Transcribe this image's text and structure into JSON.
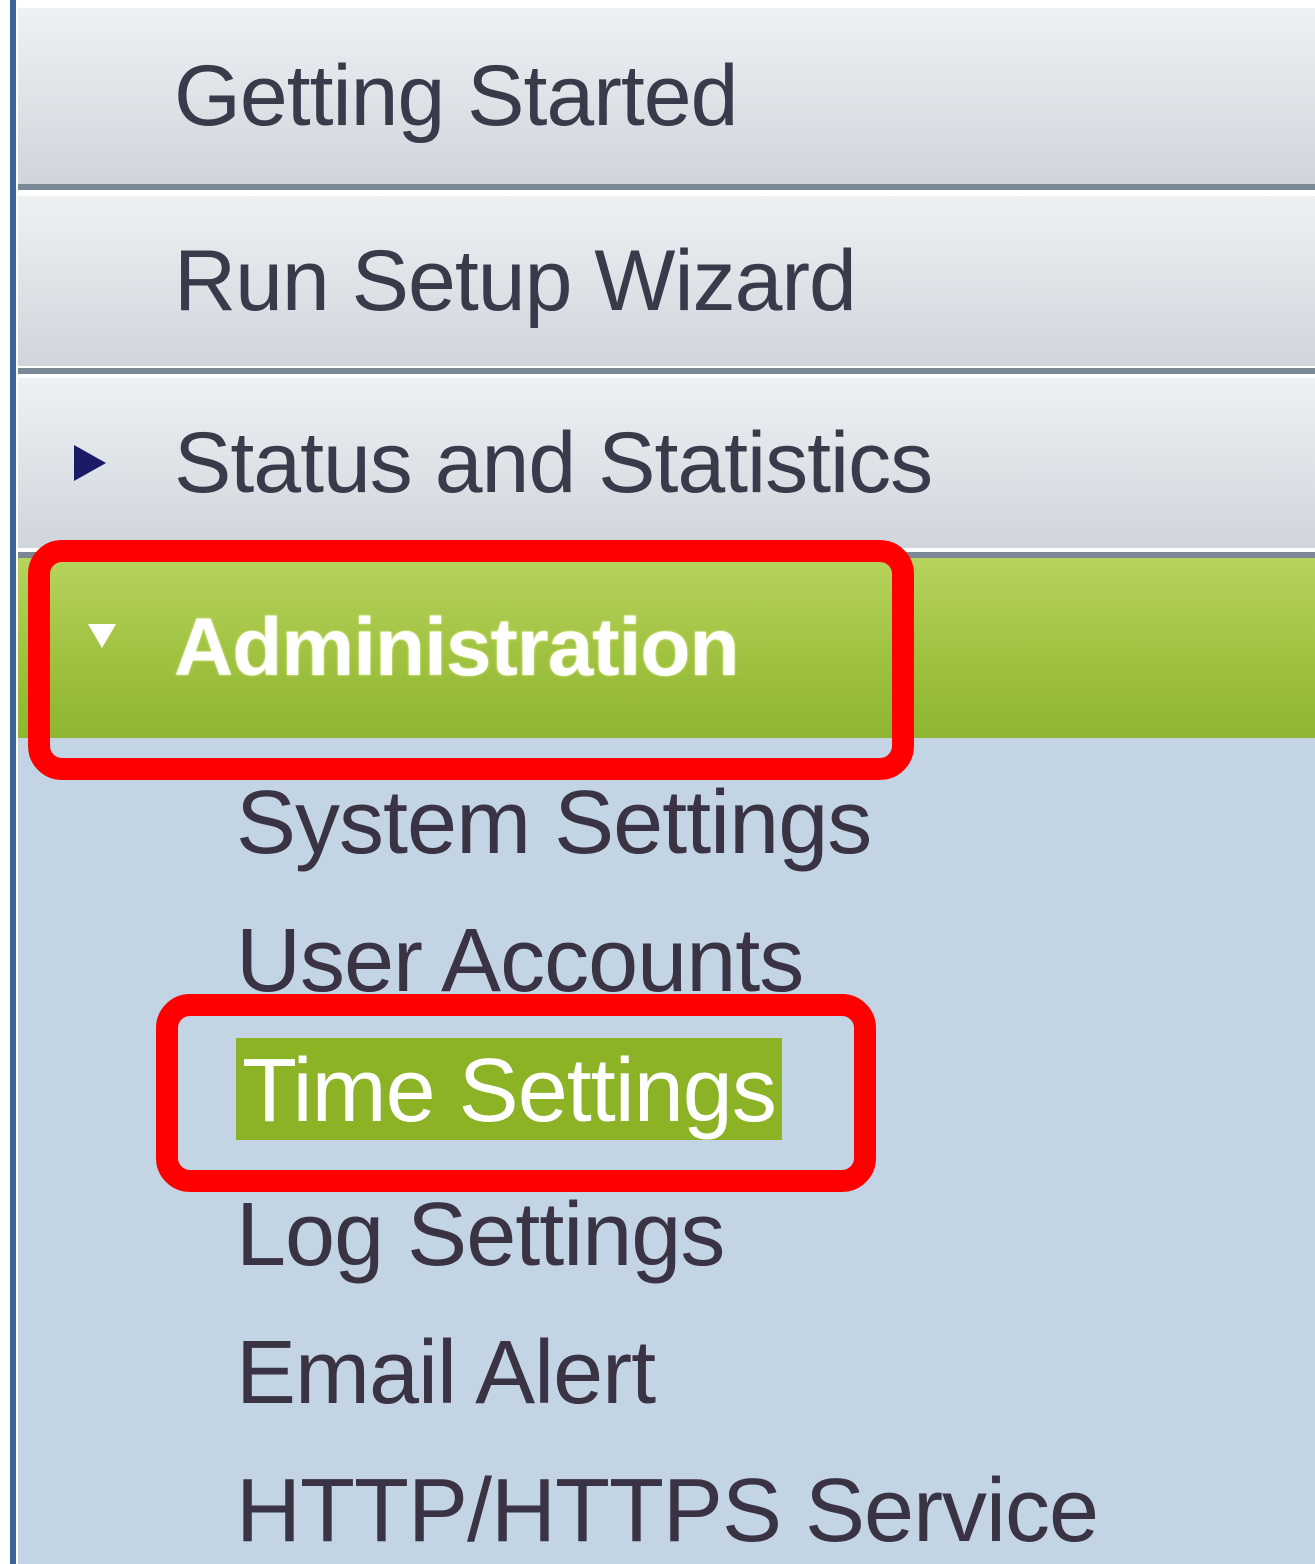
{
  "nav": {
    "top_items": [
      {
        "label": "Getting Started"
      },
      {
        "label": "Run Setup Wizard"
      },
      {
        "label": "Status and Statistics"
      }
    ],
    "admin": {
      "label": "Administration",
      "expanded": true,
      "children": [
        {
          "label": "System Settings"
        },
        {
          "label": "User Accounts"
        },
        {
          "label": "Time Settings",
          "active": true
        },
        {
          "label": "Log Settings"
        },
        {
          "label": "Email Alert"
        },
        {
          "label": "HTTP/HTTPS Service"
        }
      ]
    }
  },
  "icons": {
    "collapsed_arrow": "triangle-right-icon",
    "expanded_arrow": "triangle-down-icon"
  },
  "colors": {
    "active_green": "#8cb325",
    "callout_red": "#ff0000",
    "submenu_bg": "#c3d4e5",
    "arrow_navy": "#1a1a66"
  }
}
